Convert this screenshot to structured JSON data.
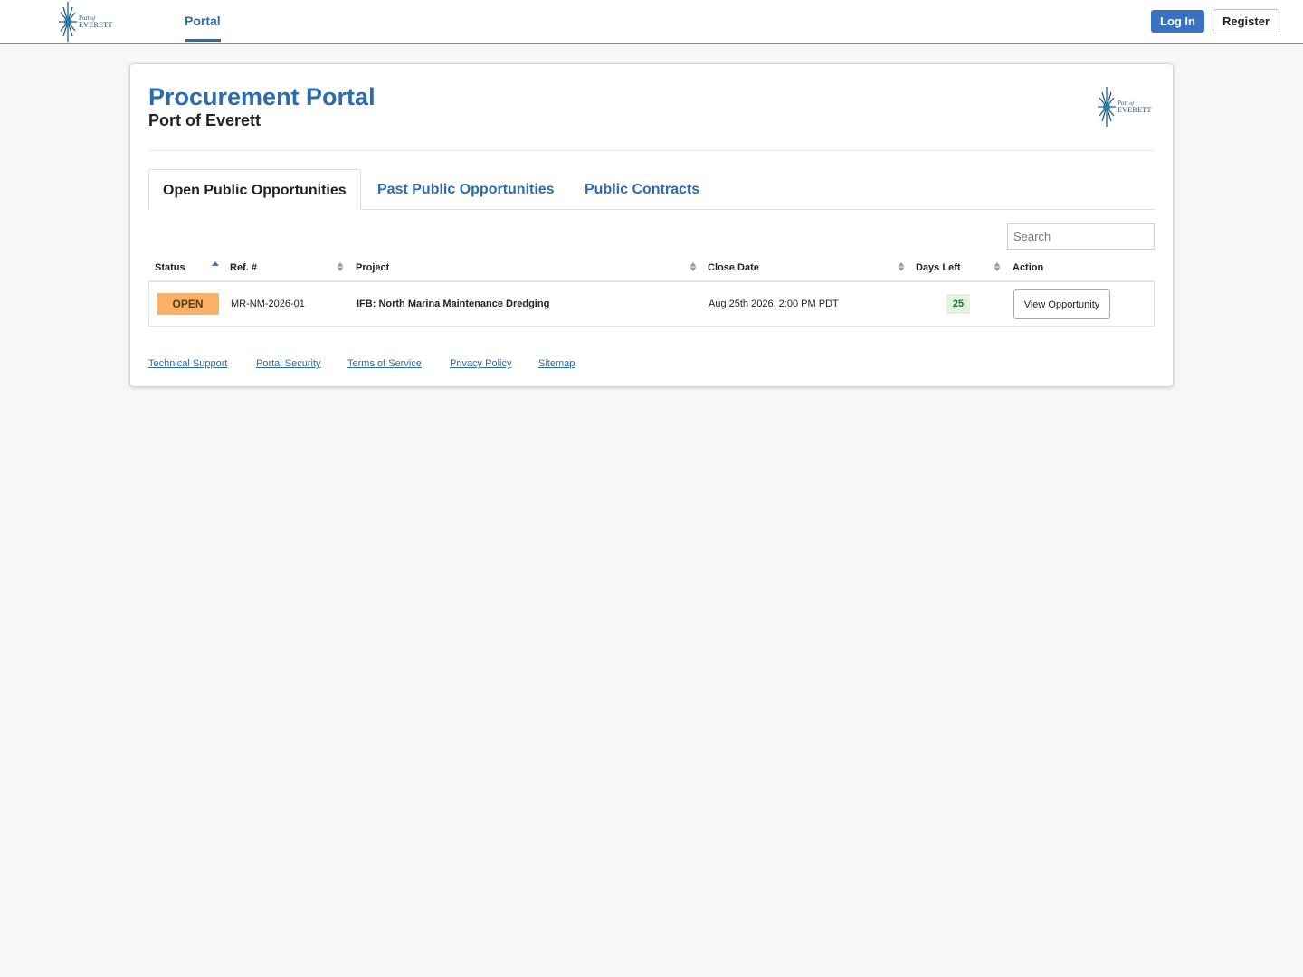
{
  "header": {
    "logo": {
      "line1": "Port",
      "line1_suffix": "of",
      "line2": "EVERETT"
    },
    "nav": {
      "portal_label": "Portal"
    },
    "login_label": "Log In",
    "register_label": "Register"
  },
  "page": {
    "title": "Procurement Portal",
    "subtitle": "Port of Everett"
  },
  "tabs": [
    {
      "label": "Open Public Opportunities",
      "active": true
    },
    {
      "label": "Past Public Opportunities",
      "active": false
    },
    {
      "label": "Public Contracts",
      "active": false
    }
  ],
  "search": {
    "placeholder": "Search",
    "value": ""
  },
  "table": {
    "columns": [
      "Status",
      "Ref. #",
      "Project",
      "Close Date",
      "Days Left",
      "Action"
    ],
    "rows": [
      {
        "status": "OPEN",
        "ref": "MR-NM-2026-01",
        "project": "IFB: North Marina Maintenance Dredging",
        "close_date": "Aug 25th 2026, 2:00 PM PDT",
        "days_left": "25",
        "action": "View Opportunity"
      }
    ]
  },
  "footer": {
    "links": [
      "Technical Support",
      "Portal Security",
      "Terms of Service",
      "Privacy Policy",
      "Sitemap"
    ]
  },
  "colors": {
    "accent": "#2b6cb0",
    "login_button": "#3a72c2",
    "status_open": "#f7b267",
    "days_left_bg": "#e2f2e2",
    "page_background": "#f7f7f8"
  },
  "icons": [
    "star-burst-logo-icon",
    "sort-ascending-icon",
    "sort-icon"
  ]
}
